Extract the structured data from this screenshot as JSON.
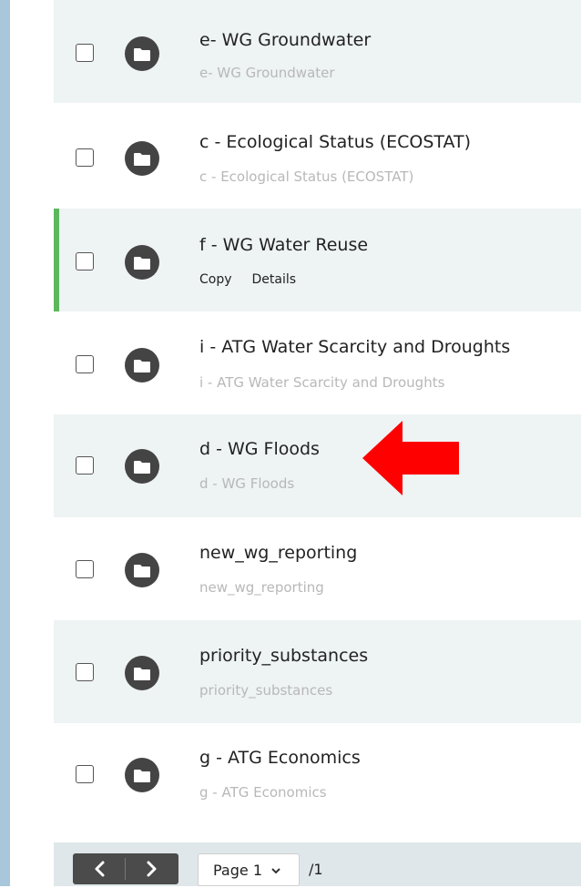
{
  "rows": [
    {
      "title": "e- WG Groundwater",
      "subtitle": "e- WG Groundwater"
    },
    {
      "title": "c - Ecological Status (ECOSTAT)",
      "subtitle": "c - Ecological Status (ECOSTAT)"
    },
    {
      "title": "f - WG Water Reuse",
      "actions": [
        "Copy",
        "Details"
      ]
    },
    {
      "title": "i - ATG Water Scarcity and Droughts",
      "subtitle": "i - ATG Water Scarcity and Droughts"
    },
    {
      "title": "d - WG Floods",
      "subtitle": "d - WG Floods"
    },
    {
      "title": "new_wg_reporting",
      "subtitle": "new_wg_reporting"
    },
    {
      "title": "priority_substances",
      "subtitle": "priority_substances"
    },
    {
      "title": "g - ATG Economics",
      "subtitle": "g - ATG Economics"
    }
  ],
  "pagination": {
    "page_label": "Page 1",
    "total_label": "/1"
  },
  "icons": {
    "row_icon": "folder-icon",
    "prev": "chevron-left-icon",
    "next": "chevron-right-icon",
    "annotation": "red-arrow-annotation"
  },
  "colors": {
    "selected_accent": "#5cb85c",
    "annotation": "#ff0000"
  }
}
